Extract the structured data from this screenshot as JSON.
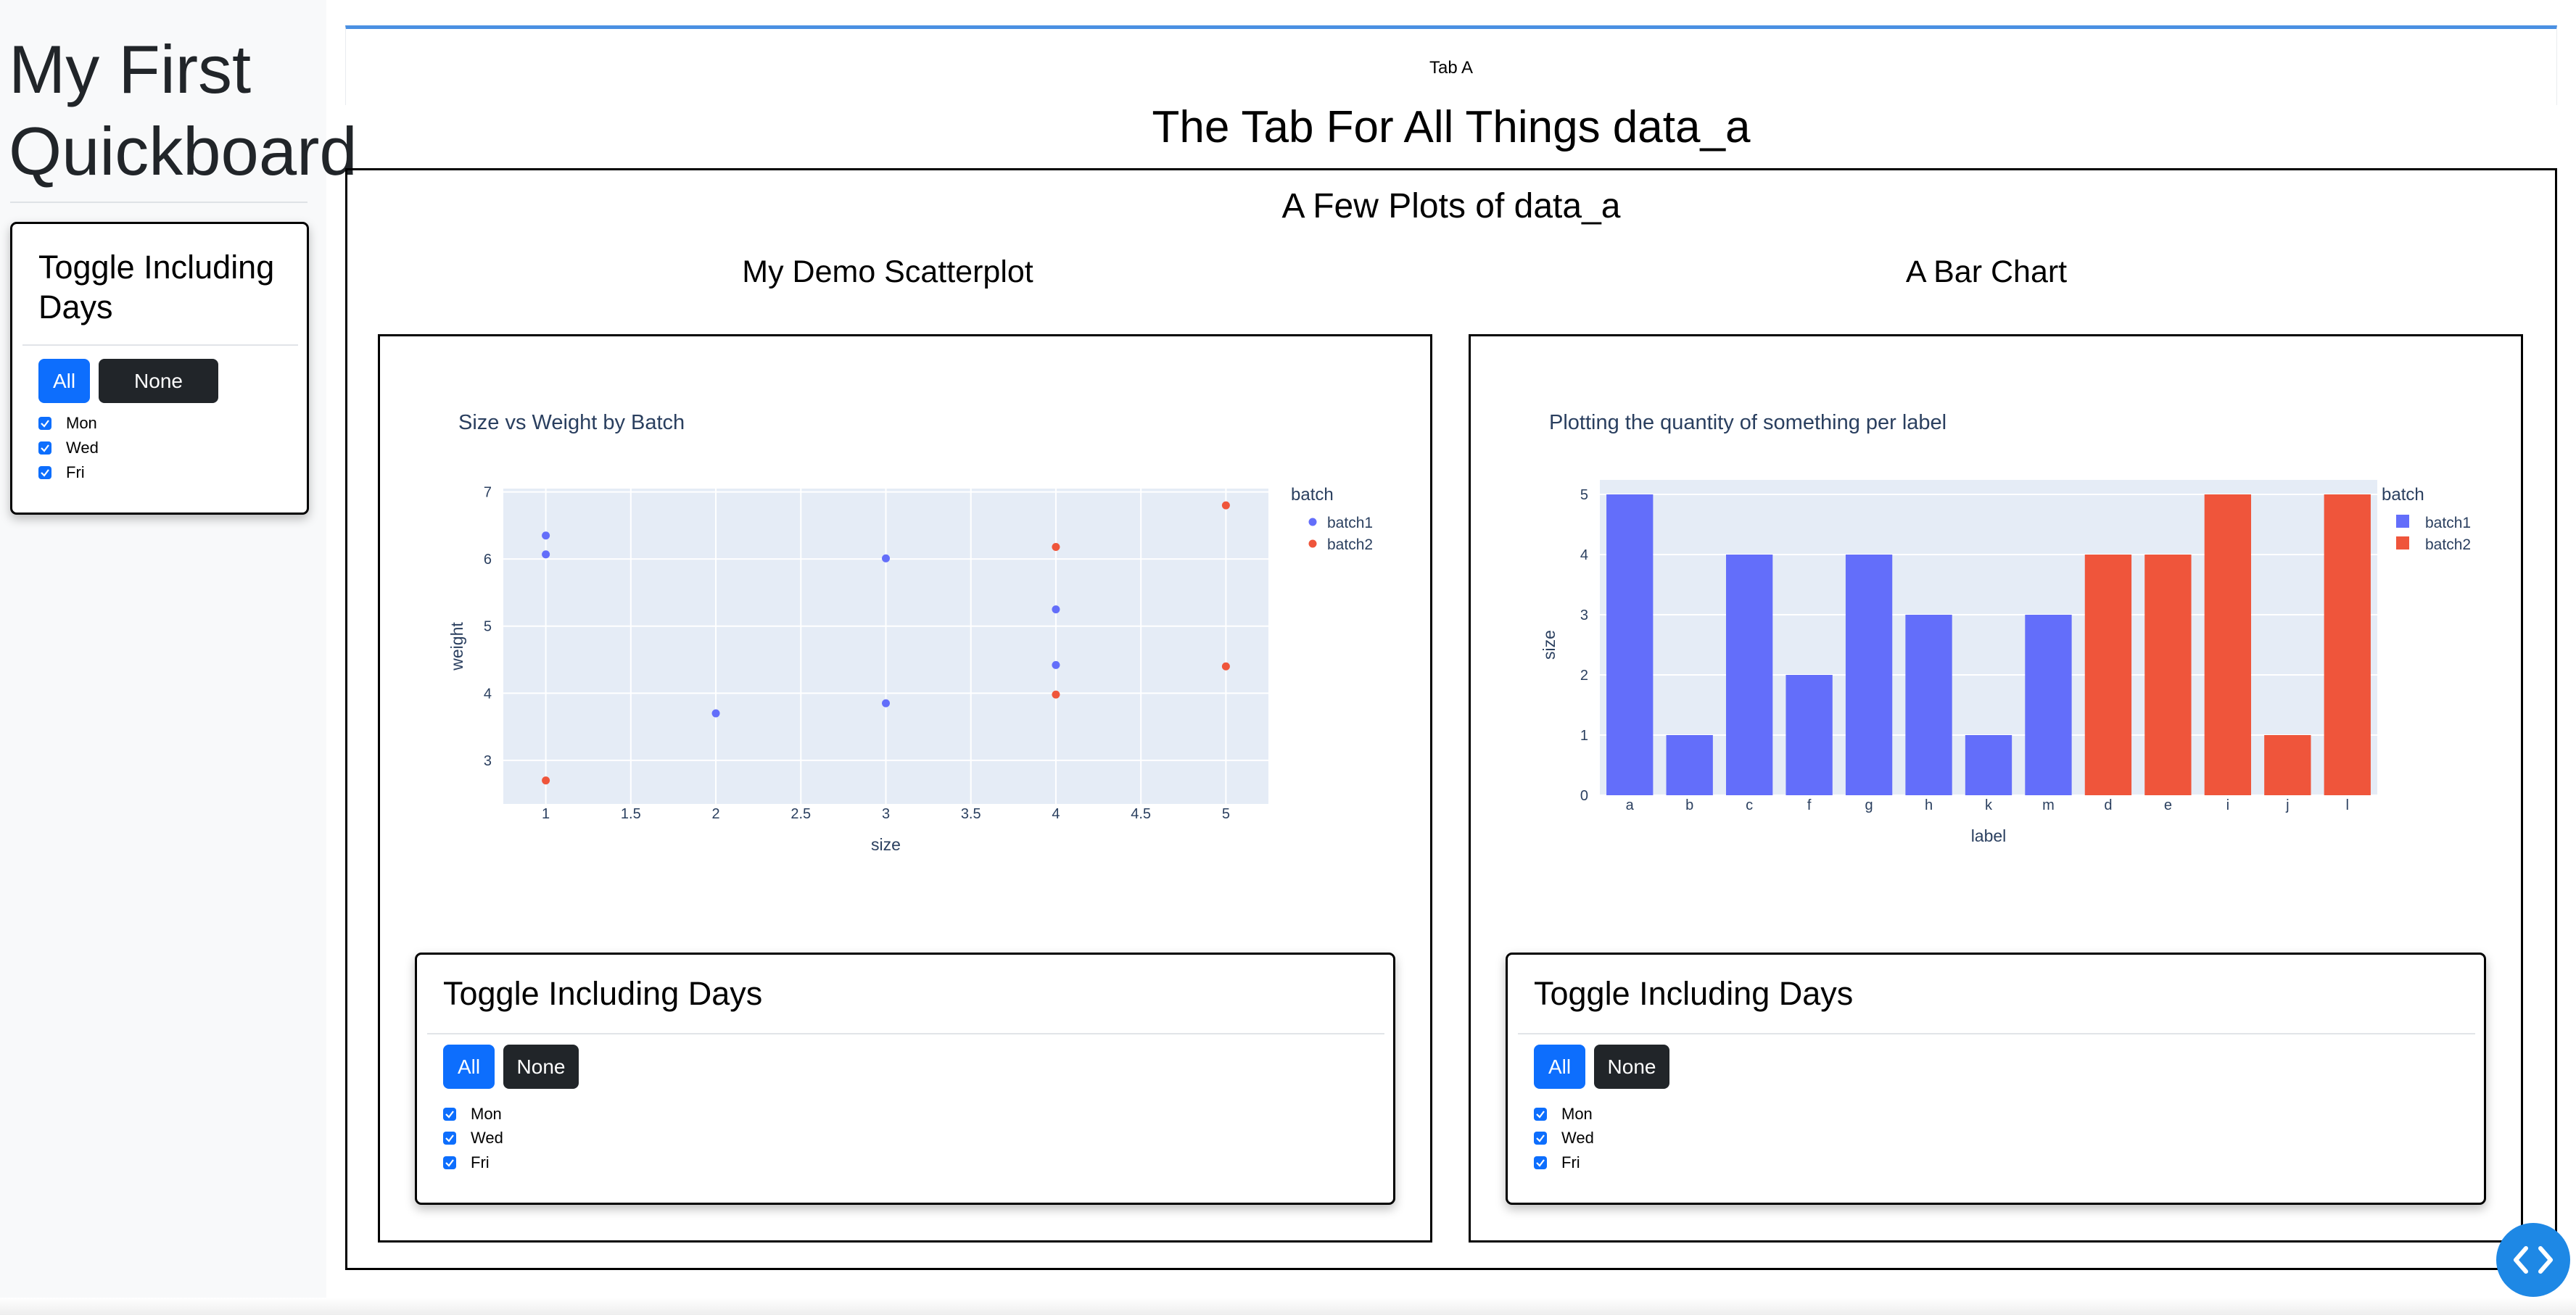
{
  "app": {
    "title": "My First Quickboard"
  },
  "sidebar": {
    "toggle": {
      "title": "Toggle Including Days",
      "all_label": "All",
      "none_label": "None",
      "options": [
        "Mon",
        "Wed",
        "Fri"
      ]
    }
  },
  "tabs": [
    {
      "label": "Tab A"
    }
  ],
  "page": {
    "heading": "The Tab For All Things data_a",
    "section_title": "A Few Plots of data_a"
  },
  "left_panel": {
    "heading": "My Demo Scatterplot",
    "toggle": {
      "title": "Toggle Including Days",
      "all_label": "All",
      "none_label": "None",
      "options": [
        "Mon",
        "Wed",
        "Fri"
      ]
    }
  },
  "right_panel": {
    "heading": "A Bar Chart",
    "toggle": {
      "title": "Toggle Including Days",
      "all_label": "All",
      "none_label": "None",
      "options": [
        "Mon",
        "Wed",
        "Fri"
      ]
    }
  },
  "colors": {
    "batch1": "#636efa",
    "batch2": "#ef553b",
    "plot_bg": "#e5ecf6",
    "accent": "#0d6efd"
  },
  "chart_data": [
    {
      "type": "scatter",
      "title": "Size vs Weight by Batch",
      "xlabel": "size",
      "ylabel": "weight",
      "xlim": [
        0.75,
        5.25
      ],
      "ylim": [
        2.35,
        7.05
      ],
      "xticks": [
        1,
        1.5,
        2,
        2.5,
        3,
        3.5,
        4,
        4.5,
        5
      ],
      "yticks": [
        3,
        4,
        5,
        6,
        7
      ],
      "legend_title": "batch",
      "legend_position": "top-right",
      "grid": true,
      "series": [
        {
          "name": "batch1",
          "x": [
            1,
            1,
            2,
            3,
            3,
            4,
            4
          ],
          "y": [
            6.35,
            6.07,
            3.7,
            6.01,
            3.85,
            5.25,
            4.42
          ]
        },
        {
          "name": "batch2",
          "x": [
            1,
            4,
            4,
            5,
            5
          ],
          "y": [
            2.7,
            6.18,
            3.98,
            6.8,
            4.4
          ]
        }
      ]
    },
    {
      "type": "bar",
      "title": "Plotting the quantity of something per label",
      "xlabel": "label",
      "ylabel": "size",
      "ylim": [
        0,
        5
      ],
      "yticks": [
        0,
        1,
        2,
        3,
        4,
        5
      ],
      "legend_title": "batch",
      "legend_position": "top-right",
      "grid": true,
      "categories": [
        "a",
        "b",
        "c",
        "f",
        "g",
        "h",
        "k",
        "m",
        "d",
        "e",
        "i",
        "j",
        "l"
      ],
      "series": [
        {
          "name": "batch1",
          "categories": [
            "a",
            "b",
            "c",
            "f",
            "g",
            "h",
            "k",
            "m"
          ],
          "values": [
            5,
            1,
            4,
            2,
            4,
            3,
            1,
            3
          ]
        },
        {
          "name": "batch2",
          "categories": [
            "d",
            "e",
            "i",
            "j",
            "l"
          ],
          "values": [
            4,
            4,
            5,
            1,
            5
          ]
        }
      ]
    }
  ]
}
